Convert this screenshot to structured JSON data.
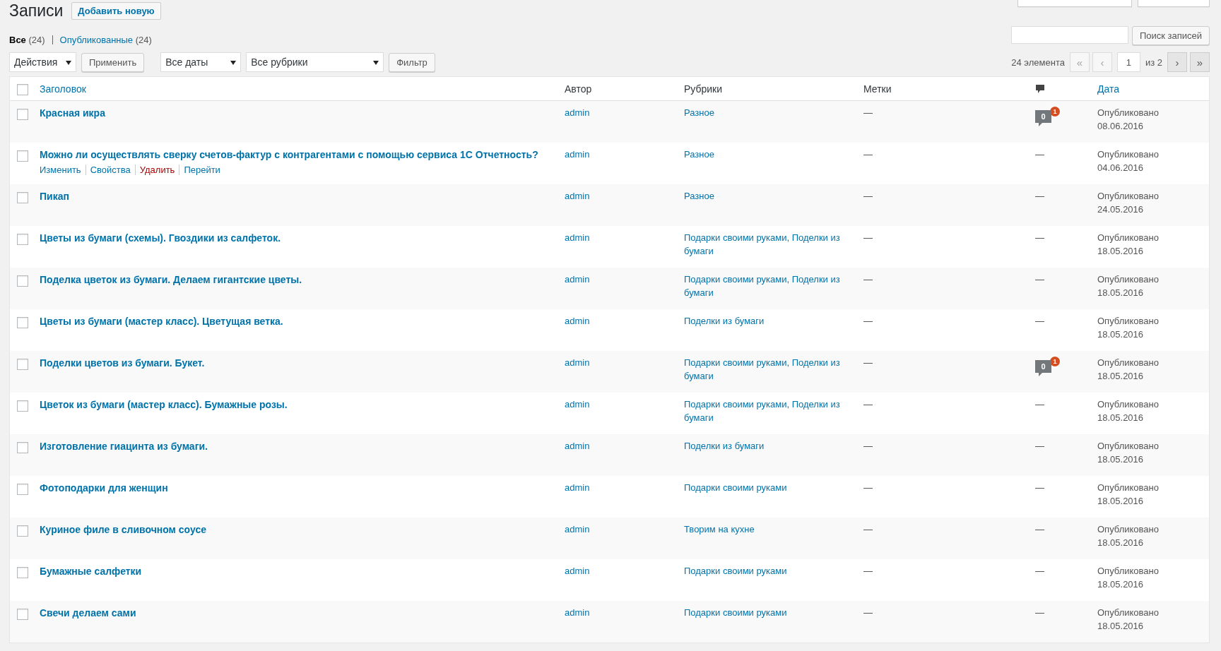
{
  "page": {
    "title": "Записи",
    "add_new": "Добавить новую"
  },
  "views": [
    {
      "label": "Все",
      "count": "(24)",
      "selected": true
    },
    {
      "label": "Опубликованные",
      "count": "(24)",
      "selected": false
    }
  ],
  "search": {
    "button": "Поиск записей"
  },
  "bulk_actions": {
    "value": "Действия",
    "apply": "Применить"
  },
  "filters": {
    "dates": "Все даты",
    "categories": "Все рубрики",
    "button": "Фильтр"
  },
  "pagination": {
    "count": "24 элемента",
    "page": "1",
    "of": "из 2",
    "before": [
      {
        "label": "«",
        "disabled": true
      },
      {
        "label": "‹",
        "disabled": true
      }
    ],
    "after": [
      {
        "label": "›",
        "disabled": false
      },
      {
        "label": "»",
        "disabled": false
      }
    ]
  },
  "table": {
    "select_all_checked": false,
    "columns": [
      {
        "label": "Заголовок",
        "kind": "link"
      },
      {
        "label": "Автор",
        "kind": "text"
      },
      {
        "label": "Рубрики",
        "kind": "text"
      },
      {
        "label": "Метки",
        "kind": "text"
      },
      {
        "kind": "icon"
      },
      {
        "label": "Дата",
        "kind": "link"
      }
    ],
    "rows": [
      {
        "checked": false,
        "title": "Красная икра",
        "author": "admin",
        "categories": "Разное",
        "tags": "—",
        "comments": {
          "kind": "bubble",
          "count": "0",
          "pending": "1"
        },
        "status": "Опубликовано",
        "date": "08.06.2016"
      },
      {
        "checked": false,
        "title": "Можно ли осуществлять сверку счетов-фактур с контрагентами с помощью сервиса 1С Отчетность?",
        "author": "admin",
        "categories": "Разное",
        "tags": "—",
        "comments": {
          "kind": "none",
          "text": "—"
        },
        "status": "Опубликовано",
        "date": "04.06.2016",
        "actions": [
          {
            "label": "Изменить",
            "kind": "normal"
          },
          {
            "label": "Свойства",
            "kind": "normal"
          },
          {
            "label": "Удалить",
            "kind": "danger"
          },
          {
            "label": "Перейти",
            "kind": "normal"
          }
        ]
      },
      {
        "checked": false,
        "title": "Пикап",
        "author": "admin",
        "categories": "Разное",
        "tags": "—",
        "comments": {
          "kind": "none",
          "text": "—"
        },
        "status": "Опубликовано",
        "date": "24.05.2016"
      },
      {
        "checked": false,
        "title": "Цветы из бумаги (схемы). Гвоздики из салфеток.",
        "author": "admin",
        "categories": "Подарки своими руками, Поделки из бумаги",
        "tags": "—",
        "comments": {
          "kind": "none",
          "text": "—"
        },
        "status": "Опубликовано",
        "date": "18.05.2016"
      },
      {
        "checked": false,
        "title": "Поделка цветок из бумаги. Делаем гигантские цветы.",
        "author": "admin",
        "categories": "Подарки своими руками, Поделки из бумаги",
        "tags": "—",
        "comments": {
          "kind": "none",
          "text": "—"
        },
        "status": "Опубликовано",
        "date": "18.05.2016"
      },
      {
        "checked": false,
        "title": "Цветы из бумаги (мастер класс). Цветущая ветка.",
        "author": "admin",
        "categories": "Поделки из бумаги",
        "tags": "—",
        "comments": {
          "kind": "none",
          "text": "—"
        },
        "status": "Опубликовано",
        "date": "18.05.2016"
      },
      {
        "checked": false,
        "title": "Поделки цветов из бумаги. Букет.",
        "author": "admin",
        "categories": "Подарки своими руками, Поделки из бумаги",
        "tags": "—",
        "comments": {
          "kind": "bubble",
          "count": "0",
          "pending": "1"
        },
        "status": "Опубликовано",
        "date": "18.05.2016"
      },
      {
        "checked": false,
        "title": "Цветок из бумаги (мастер класс). Бумажные розы.",
        "author": "admin",
        "categories": "Подарки своими руками, Поделки из бумаги",
        "tags": "—",
        "comments": {
          "kind": "none",
          "text": "—"
        },
        "status": "Опубликовано",
        "date": "18.05.2016"
      },
      {
        "checked": false,
        "title": "Изготовление гиацинта из бумаги.",
        "author": "admin",
        "categories": "Поделки из бумаги",
        "tags": "—",
        "comments": {
          "kind": "none",
          "text": "—"
        },
        "status": "Опубликовано",
        "date": "18.05.2016"
      },
      {
        "checked": false,
        "title": "Фотоподарки для женщин",
        "author": "admin",
        "categories": "Подарки своими руками",
        "tags": "—",
        "comments": {
          "kind": "none",
          "text": "—"
        },
        "status": "Опубликовано",
        "date": "18.05.2016"
      },
      {
        "checked": false,
        "title": "Куриное филе в сливочном соусе",
        "author": "admin",
        "categories": "Творим на кухне",
        "tags": "—",
        "comments": {
          "kind": "none",
          "text": "—"
        },
        "status": "Опубликовано",
        "date": "18.05.2016"
      },
      {
        "checked": false,
        "title": "Бумажные салфетки",
        "author": "admin",
        "categories": "Подарки своими руками",
        "tags": "—",
        "comments": {
          "kind": "none",
          "text": "—"
        },
        "status": "Опубликовано",
        "date": "18.05.2016"
      },
      {
        "checked": false,
        "title": "Свечи делаем сами",
        "author": "admin",
        "categories": "Подарки своими руками",
        "tags": "—",
        "comments": {
          "kind": "none",
          "text": "—"
        },
        "status": "Опубликовано",
        "date": "18.05.2016"
      }
    ]
  }
}
